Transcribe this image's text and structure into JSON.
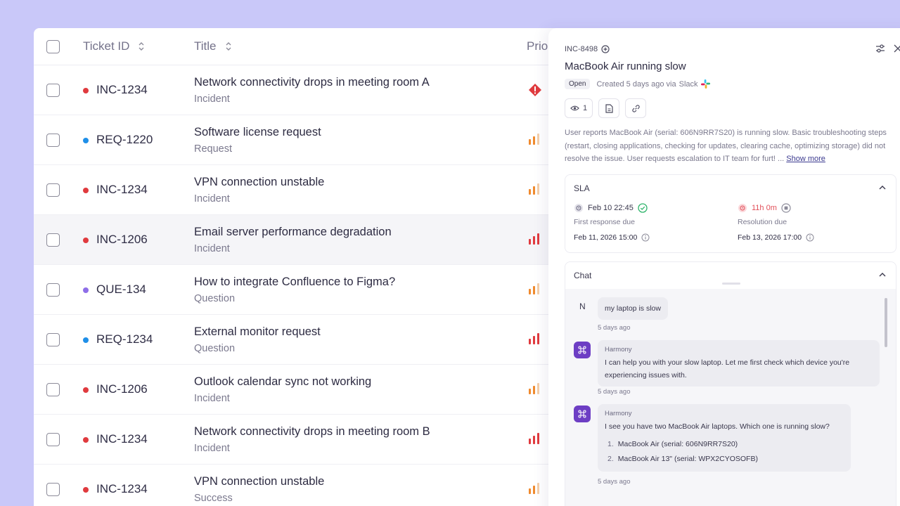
{
  "table": {
    "headers": {
      "ticket_id": "Ticket ID",
      "title": "Title",
      "priority": "Prio"
    },
    "rows": [
      {
        "id": "INC-1234",
        "dot": "#e03a3e",
        "title": "Network connectivity drops in meeting room A",
        "type": "Incident",
        "priority": "urgent"
      },
      {
        "id": "REQ-1220",
        "dot": "#1f8fe8",
        "title": "Software license request",
        "type": "Request",
        "priority": "medium"
      },
      {
        "id": "INC-1234",
        "dot": "#e03a3e",
        "title": "VPN connection unstable",
        "type": "Incident",
        "priority": "medium"
      },
      {
        "id": "INC-1206",
        "dot": "#e03a3e",
        "title": "Email server performance degradation",
        "type": "Incident",
        "priority": "high"
      },
      {
        "id": "QUE-134",
        "dot": "#8e6ee8",
        "title": "How to integrate Confluence to Figma?",
        "type": "Question",
        "priority": "medium"
      },
      {
        "id": "REQ-1234",
        "dot": "#1f8fe8",
        "title": "External monitor request",
        "type": "Question",
        "priority": "high"
      },
      {
        "id": "INC-1206",
        "dot": "#e03a3e",
        "title": "Outlook calendar sync not working",
        "type": "Incident",
        "priority": "medium"
      },
      {
        "id": "INC-1234",
        "dot": "#e03a3e",
        "title": "Network connectivity drops in meeting room B",
        "type": "Incident",
        "priority": "high"
      },
      {
        "id": "INC-1234",
        "dot": "#e03a3e",
        "title": "VPN connection unstable",
        "type": "Success",
        "priority": "medium"
      }
    ]
  },
  "panel": {
    "ticket_id": "INC-8498",
    "title": "MacBook Air running slow",
    "status": "Open",
    "created": "Created 5 days ago via",
    "source": "Slack",
    "watchers": "1",
    "description": "User reports MacBook Air (serial: 606N9RR7S20) is running slow. Basic troubleshooting steps (restart, closing applications, checking for updates, clearing cache, optimizing storage) did not resolve the issue. User requests escalation to IT team for furt! ...",
    "show_more": "Show more",
    "sla": {
      "heading": "SLA",
      "first_time": "Feb 10 22:45",
      "first_label": "First response due",
      "first_due": "Feb 11, 2026 15:00",
      "res_time": "11h 0m",
      "res_label": "Resolution due",
      "res_due": "Feb 13, 2026 17:00"
    },
    "chat": {
      "heading": "Chat",
      "user_initial": "N",
      "user_msg": "my laptop is slow",
      "user_ago": "5 days ago",
      "bot_name": "Harmony",
      "bot_msg1": "I can help you with your slow laptop. Let me first check which device you're experiencing issues with.",
      "bot_ago1": "5 days ago",
      "bot_msg2": "I see you have two MacBook Air laptops. Which one is running slow?",
      "bot_options": [
        "MacBook Air (serial: 606N9RR7S20)",
        "MacBook Air 13\" (serial: WPX2CYOSOFB)"
      ],
      "bot_ago2": "5 days ago"
    }
  },
  "colors": {
    "background": "#c9c8f9",
    "accent": "#6d3ec4",
    "urgent": "#e03a3e",
    "priority_bar": "#f08a2e"
  }
}
